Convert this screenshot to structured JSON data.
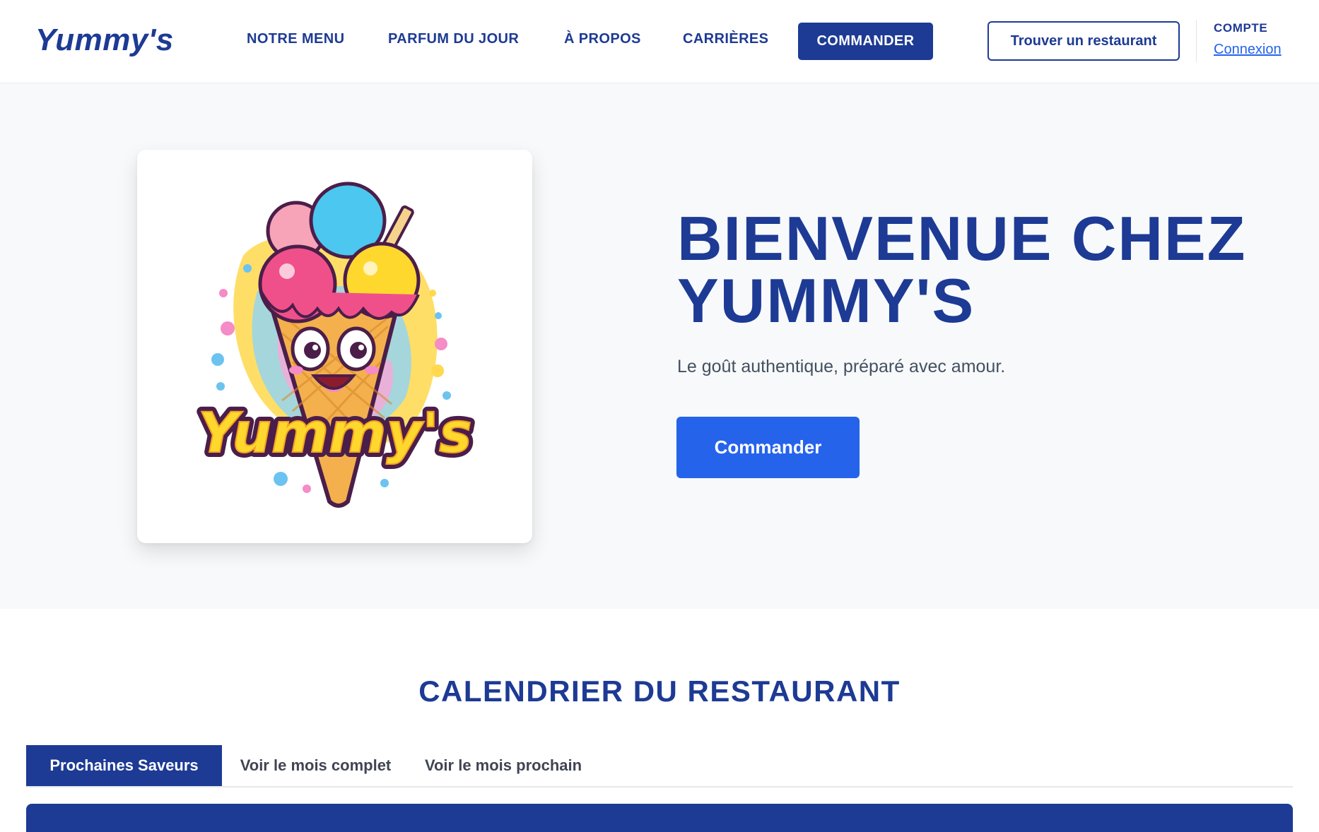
{
  "brand": {
    "name": "Yummy's"
  },
  "nav": {
    "items": [
      {
        "label": "NOTRE MENU"
      },
      {
        "label": "PARFUM DU JOUR"
      },
      {
        "label": "À PROPOS"
      },
      {
        "label": "CARRIÈRES"
      }
    ],
    "cta_label": "COMMANDER"
  },
  "header": {
    "find_restaurant_label": "Trouver un restaurant",
    "account_label": "COMPTE",
    "login_label": "Connexion"
  },
  "hero": {
    "logo_text": "Yummy's",
    "title": "BIENVENUE CHEZ YUMMY'S",
    "subtitle": "Le goût authentique, préparé avec amour.",
    "button_label": "Commander"
  },
  "calendar": {
    "title": "CALENDRIER DU RESTAURANT",
    "tabs": [
      {
        "label": "Prochaines Saveurs",
        "active": true
      },
      {
        "label": "Voir le mois complet",
        "active": false
      },
      {
        "label": "Voir le mois prochain",
        "active": false
      }
    ]
  },
  "colors": {
    "primary": "#1d3a94",
    "accent": "#2563eb",
    "hero_background": "#f7f9fb"
  }
}
